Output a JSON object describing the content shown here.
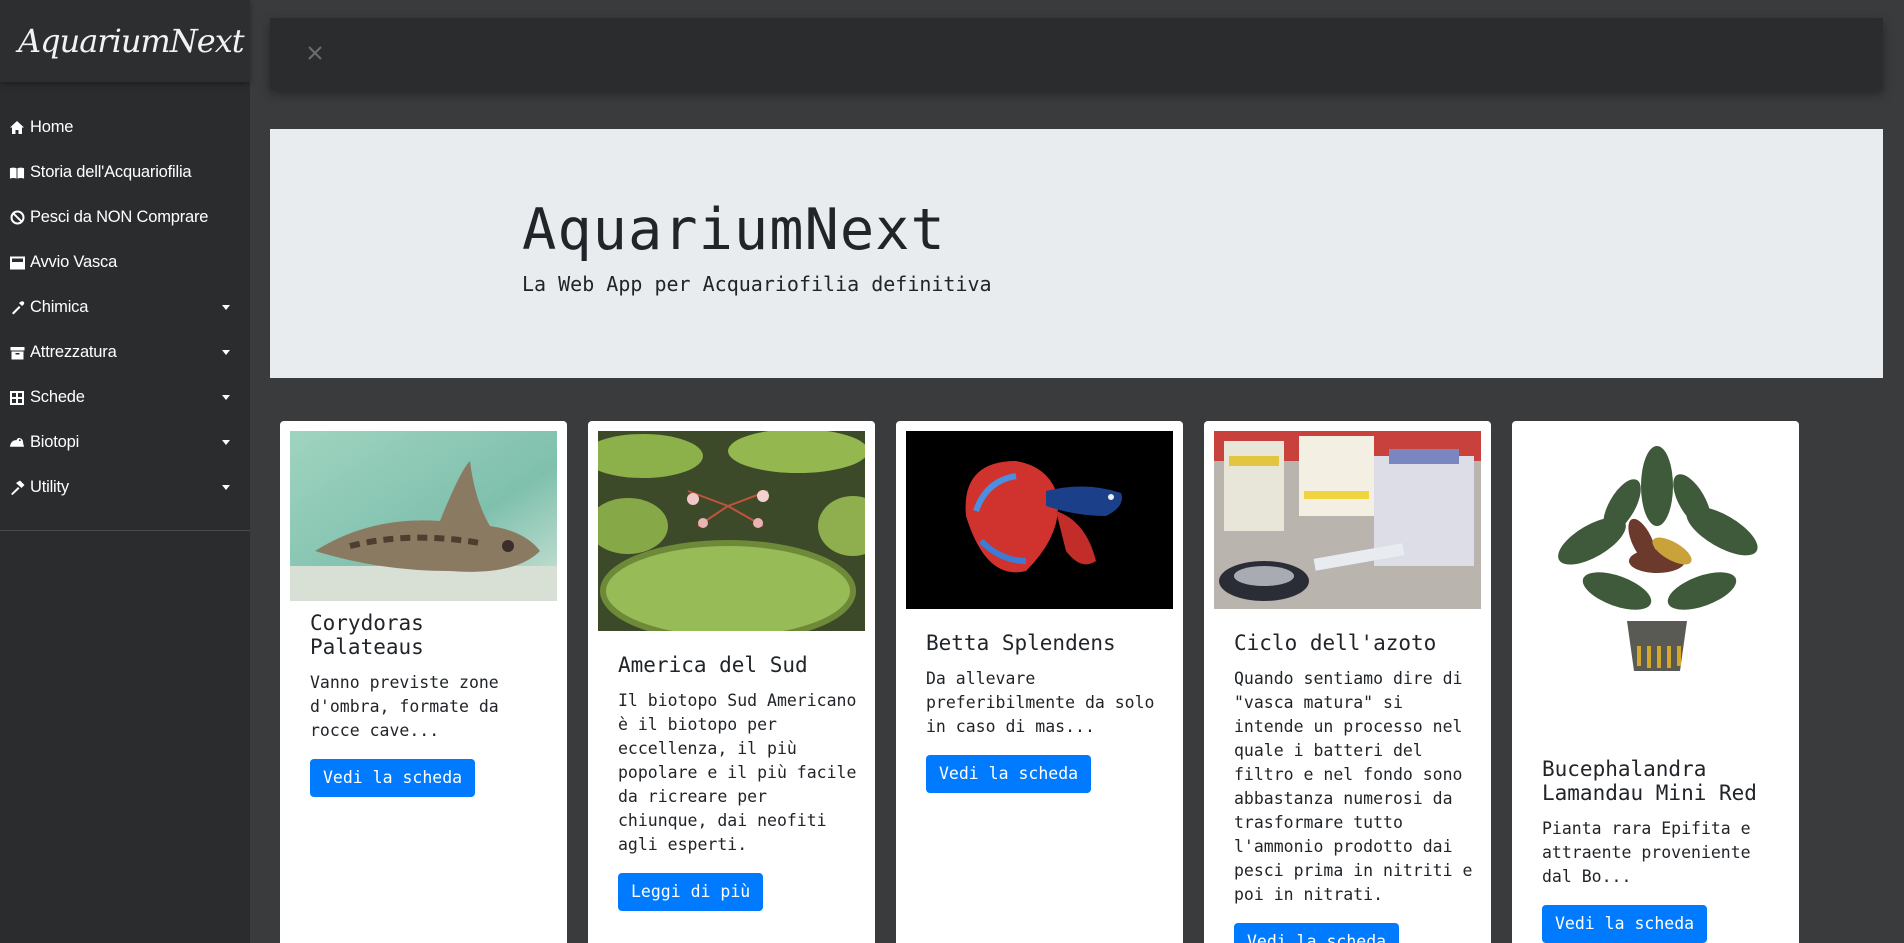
{
  "sidebar": {
    "brand": "AquariumNext",
    "items": [
      {
        "label": "Home",
        "icon": "home-icon",
        "dropdown": false
      },
      {
        "label": "Storia dell'Acquariofilia",
        "icon": "book-open-icon",
        "dropdown": false
      },
      {
        "label": "Pesci da NON Comprare",
        "icon": "ban-icon",
        "dropdown": false
      },
      {
        "label": "Avvio Vasca",
        "icon": "aquarium-tank-icon",
        "dropdown": false
      },
      {
        "label": "Chimica",
        "icon": "eyedropper-icon",
        "dropdown": true
      },
      {
        "label": "Attrezzatura",
        "icon": "archive-box-icon",
        "dropdown": true
      },
      {
        "label": "Schede",
        "icon": "grid-table-icon",
        "dropdown": true
      },
      {
        "label": "Biotopi",
        "icon": "frog-icon",
        "dropdown": true
      },
      {
        "label": "Utility",
        "icon": "hammer-icon",
        "dropdown": true
      }
    ]
  },
  "topbar": {
    "close_icon": "close-icon"
  },
  "jumbotron": {
    "title": "AquariumNext",
    "subtitle": "La Web App per Acquariofilia definitiva"
  },
  "cards": [
    {
      "title": "Corydoras Palateaus",
      "text": "Vanno previste zone d'ombra, formate da rocce cave...",
      "button": "Vedi la scheda",
      "image": "corydoras-fish-image"
    },
    {
      "title": "America del Sud",
      "text": "Il biotopo Sud Americano è il biotopo per eccellenza, il più popolare e il più facile da ricreare per chiunque, dai neofiti agli esperti.",
      "button": "Leggi di più",
      "image": "giant-water-lilies-image"
    },
    {
      "title": "Betta Splendens",
      "text": "Da allevare preferibilmente da solo in caso di mas...",
      "button": "Vedi la scheda",
      "image": "betta-fish-image"
    },
    {
      "title": "Ciclo dell'azoto",
      "text": "Quando sentiamo dire di \"vasca matura\" si intende un processo nel quale i batteri del filtro e nel fondo sono abbastanza numerosi da trasformare tutto l'ammonio prodotto dai pesci prima in nitriti e poi in nitrati.",
      "button": "Vedi la scheda",
      "image": "lab-equipment-image"
    },
    {
      "title": "Bucephalandra Lamandau Mini Red",
      "text": "Pianta rara Epifita e attraente proveniente dal Bo...",
      "button": "Vedi la scheda",
      "image": "potted-plant-image"
    }
  ],
  "colors": {
    "primary": "#007bff",
    "sidebar": "#2b2c2e",
    "background": "#3a3b3d",
    "jumbotron": "#e9ecef"
  }
}
